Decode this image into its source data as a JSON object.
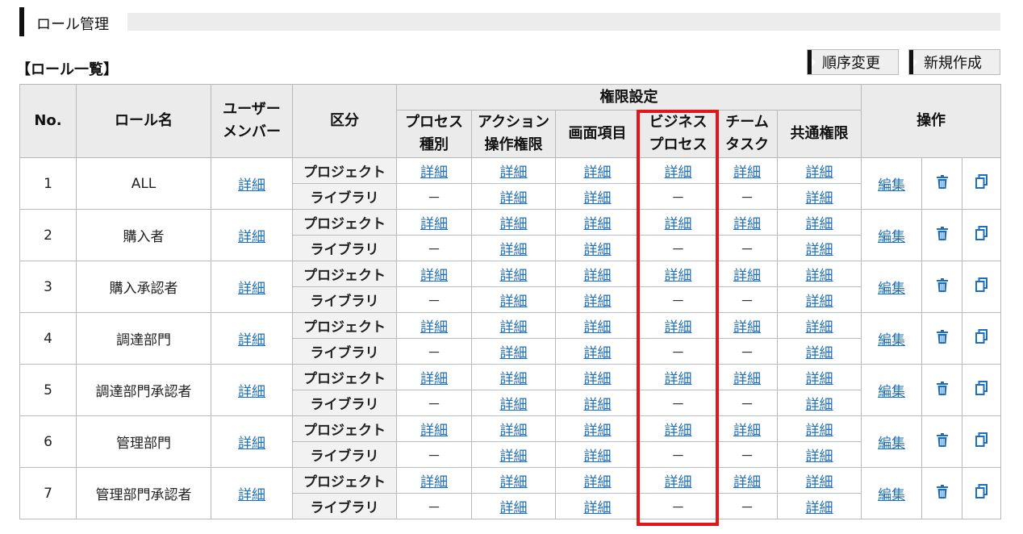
{
  "page": {
    "title": "ロール管理",
    "list_heading": "【ロール一覧】",
    "buttons": {
      "order_change": "順序変更",
      "create_new": "新規作成"
    }
  },
  "table": {
    "headers": {
      "no": "No.",
      "role_name": "ロール名",
      "user_member_line1": "ユーザー",
      "user_member_line2": "メンバー",
      "kubun": "区分",
      "permission_settings": "権限設定",
      "process_type_line1": "プロセス",
      "process_type_line2": "種別",
      "action_perm_line1": "アクション",
      "action_perm_line2": "操作権限",
      "screen_items": "画面項目",
      "business_process_line1": "ビジネス",
      "business_process_line2": "プロセス",
      "team_task_line1": "チーム",
      "team_task_line2": "タスク",
      "common_perm": "共通権限",
      "operations": "操作"
    },
    "link_detail": "詳細",
    "link_edit": "編集",
    "dash": "－",
    "kubun_project": "プロジェクト",
    "kubun_library": "ライブラリ",
    "rows": [
      {
        "no": "1",
        "name": "ALL"
      },
      {
        "no": "2",
        "name": "購入者"
      },
      {
        "no": "3",
        "name": "購入承認者"
      },
      {
        "no": "4",
        "name": "調達部門"
      },
      {
        "no": "5",
        "name": "調達部門承認者"
      },
      {
        "no": "6",
        "name": "管理部門"
      },
      {
        "no": "7",
        "name": "管理部門承認者"
      }
    ]
  },
  "icons": {
    "delete": "trash-icon",
    "copy": "copy-icon"
  },
  "colors": {
    "link": "#1f6fb6",
    "header_bg": "#ebebeb",
    "highlight": "#e3161b"
  }
}
